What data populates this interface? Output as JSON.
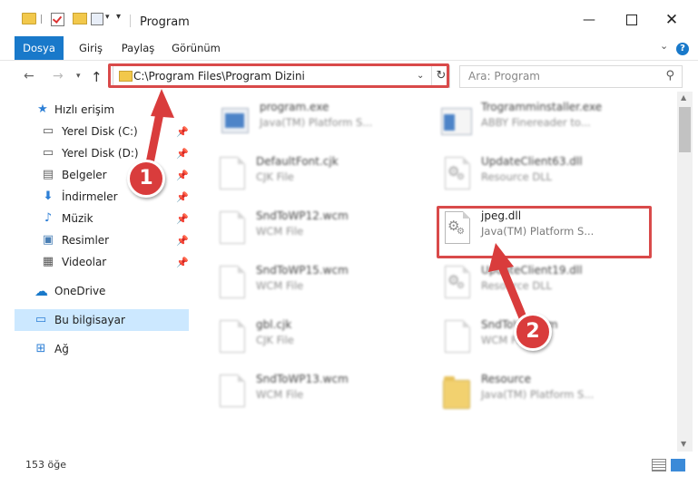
{
  "window": {
    "title": "Program",
    "minimize_glyph": "—",
    "maximize_glyph": "",
    "close_glyph": "✕"
  },
  "ribbon": {
    "tabs": [
      "Dosya",
      "Giriş",
      "Paylaş",
      "Görünüm"
    ],
    "help_glyph": "?"
  },
  "navigation": {
    "address": "C:\\Program Files\\Program Dizini",
    "search_placeholder": "Ara: Program"
  },
  "sidebar": {
    "items": [
      {
        "label": "Hızlı erişim",
        "icon": "star-icon",
        "pinned": false
      },
      {
        "label": "Yerel Disk (C:)",
        "icon": "drive-icon",
        "pinned": true
      },
      {
        "label": "Yerel Disk (D:)",
        "icon": "drive-icon",
        "pinned": true
      },
      {
        "label": "Belgeler",
        "icon": "documents-icon",
        "pinned": true
      },
      {
        "label": "İndirmeler",
        "icon": "download-icon",
        "pinned": true
      },
      {
        "label": "Müzik",
        "icon": "music-icon",
        "pinned": true
      },
      {
        "label": "Resimler",
        "icon": "pictures-icon",
        "pinned": true
      },
      {
        "label": "Videolar",
        "icon": "videos-icon",
        "pinned": true
      },
      {
        "label": "OneDrive",
        "icon": "cloud-icon",
        "pinned": false
      },
      {
        "label": "Bu bilgisayar",
        "icon": "computer-icon",
        "pinned": false,
        "selected": true
      },
      {
        "label": "Ağ",
        "icon": "network-icon",
        "pinned": false
      }
    ]
  },
  "files": [
    {
      "name": "program.exe",
      "desc": "Java(TM) Platform S...",
      "icon": "exe-icon",
      "blurred": true
    },
    {
      "name": "Trogramminstaller.exe",
      "desc": "ABBY Finereader to...",
      "icon": "installer-icon",
      "blurred": true
    },
    {
      "name": "DefaultFont.cjk",
      "desc": "CJK File",
      "icon": "document-icon",
      "blurred": true
    },
    {
      "name": "UpdateClient63.dll",
      "desc": "Resource DLL",
      "icon": "dll-icon",
      "blurred": true
    },
    {
      "name": "SndToWP12.wcm",
      "desc": "WCM File",
      "icon": "document-icon",
      "blurred": true
    },
    {
      "name": "jpeg.dll",
      "desc": "Java(TM) Platform S...",
      "icon": "dll-icon",
      "blurred": false
    },
    {
      "name": "SndToWP15.wcm",
      "desc": "WCM File",
      "icon": "document-icon",
      "blurred": true
    },
    {
      "name": "UpdateClient19.dll",
      "desc": "Resource DLL",
      "icon": "dll-icon",
      "blurred": true
    },
    {
      "name": "gbl.cjk",
      "desc": "CJK File",
      "icon": "document-icon",
      "blurred": true
    },
    {
      "name": "SndToWP.wcm",
      "desc": "WCM File",
      "icon": "document-icon",
      "blurred": true
    },
    {
      "name": "SndToWP13.wcm",
      "desc": "WCM File",
      "icon": "document-icon",
      "blurred": true
    },
    {
      "name": "Resource",
      "desc": "Java(TM) Platform S...",
      "icon": "folder-icon",
      "blurred": true
    }
  ],
  "status": {
    "item_count": "153 öğe"
  },
  "annotations": {
    "step1": "1",
    "step2": "2",
    "color": "#d93c3c"
  }
}
